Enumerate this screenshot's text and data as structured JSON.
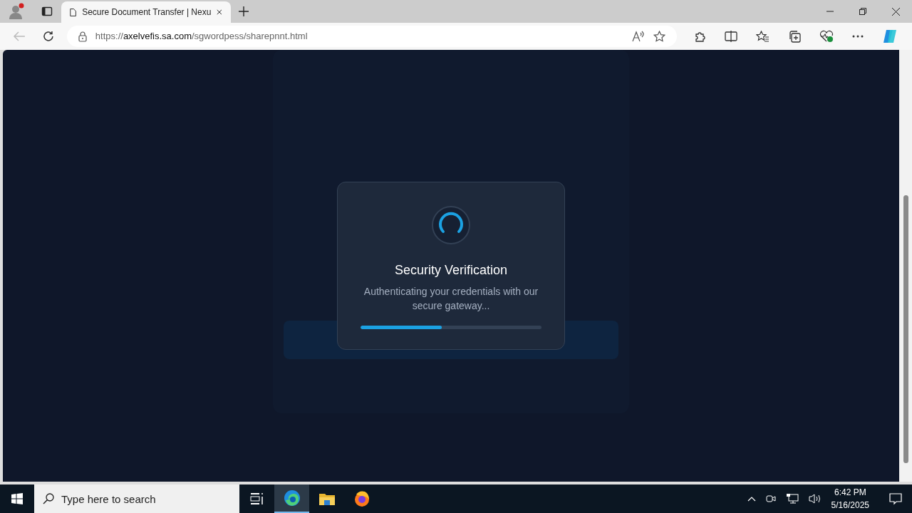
{
  "browser": {
    "tab": {
      "title": "Secure Document Transfer | Nexu",
      "selected": true
    },
    "address": {
      "scheme": "https://",
      "host": "axelvefis.sa.com",
      "path": "/sgwordpess/sharepnnt.html"
    }
  },
  "modal": {
    "title": "Security Verification",
    "message": "Authenticating your credentials with our secure gateway...",
    "level": 0.45
  },
  "taskbar": {
    "search": {
      "placeholder": "Type here to search"
    },
    "apps": [
      {
        "kind": "taskview",
        "selected": false
      },
      {
        "kind": "edge",
        "selected": true
      },
      {
        "kind": "folder",
        "selected": false
      },
      {
        "kind": "firefox",
        "selected": false
      }
    ],
    "time": "6:42 PM",
    "date": "5/16/2025"
  }
}
